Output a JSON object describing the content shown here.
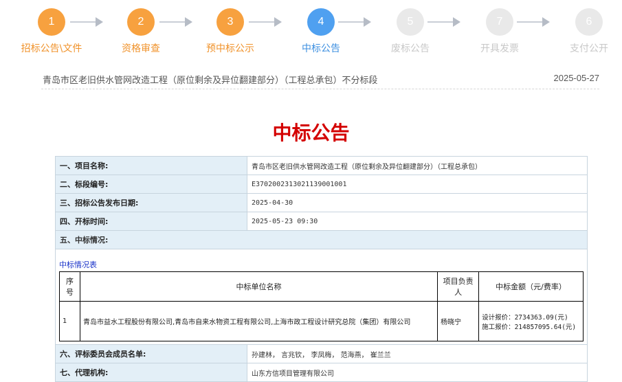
{
  "steps": [
    {
      "num": "1",
      "label": "招标公告\\文件",
      "state": "done"
    },
    {
      "num": "2",
      "label": "资格审查",
      "state": "done"
    },
    {
      "num": "3",
      "label": "预中标公示",
      "state": "done"
    },
    {
      "num": "4",
      "label": "中标公告",
      "state": "current"
    },
    {
      "num": "5",
      "label": "废标公告",
      "state": "todo"
    },
    {
      "num": "7",
      "label": "开具发票",
      "state": "todo"
    },
    {
      "num": "6",
      "label": "支付公开",
      "state": "todo"
    }
  ],
  "project": {
    "title": "青岛市区老旧供水管网改造工程（原位剩余及异位翻建部分）（工程总承包）不分标段",
    "date": "2025-05-27"
  },
  "notice": {
    "heading": "中标公告",
    "project_name_label": "一、项目名称:",
    "project_name": "青岛市区老旧供水管网改造工程（原位剩余及异位翻建部分）（工程总承包）",
    "section_no_label": "二、标段编号:",
    "section_no": "E3702002313021139001001",
    "publish_date_label": "三、招标公告发布日期:",
    "publish_date": "2025-04-30",
    "open_time_label": "四、开标时间:",
    "open_time": "2025-05-23 09:30",
    "win_status_label": "五、中标情况:",
    "win_table_caption": "中标情况表",
    "win_table_headers": {
      "no": "序号",
      "unit": "中标单位名称",
      "leader": "项目负责人",
      "amount": "中标金额（元/费率）"
    },
    "win_rows": [
      {
        "no": "1",
        "unit": "青岛市益水工程股份有限公司,青岛市自来水物资工程有限公司,上海市政工程设计研究总院（集团）有限公司",
        "leader": "杨晓宁",
        "amount_design": "设计报价：2734363.09(元)",
        "amount_build": "施工报价：214857095.64(元)"
      }
    ],
    "committee_label": "六、评标委员会成员名单:",
    "committee": "孙建林， 言兆钦， 李凤梅， 范海燕， 崔兰兰",
    "agency_label": "七、代理机构:",
    "agency": "山东方信项目管理有限公司"
  }
}
